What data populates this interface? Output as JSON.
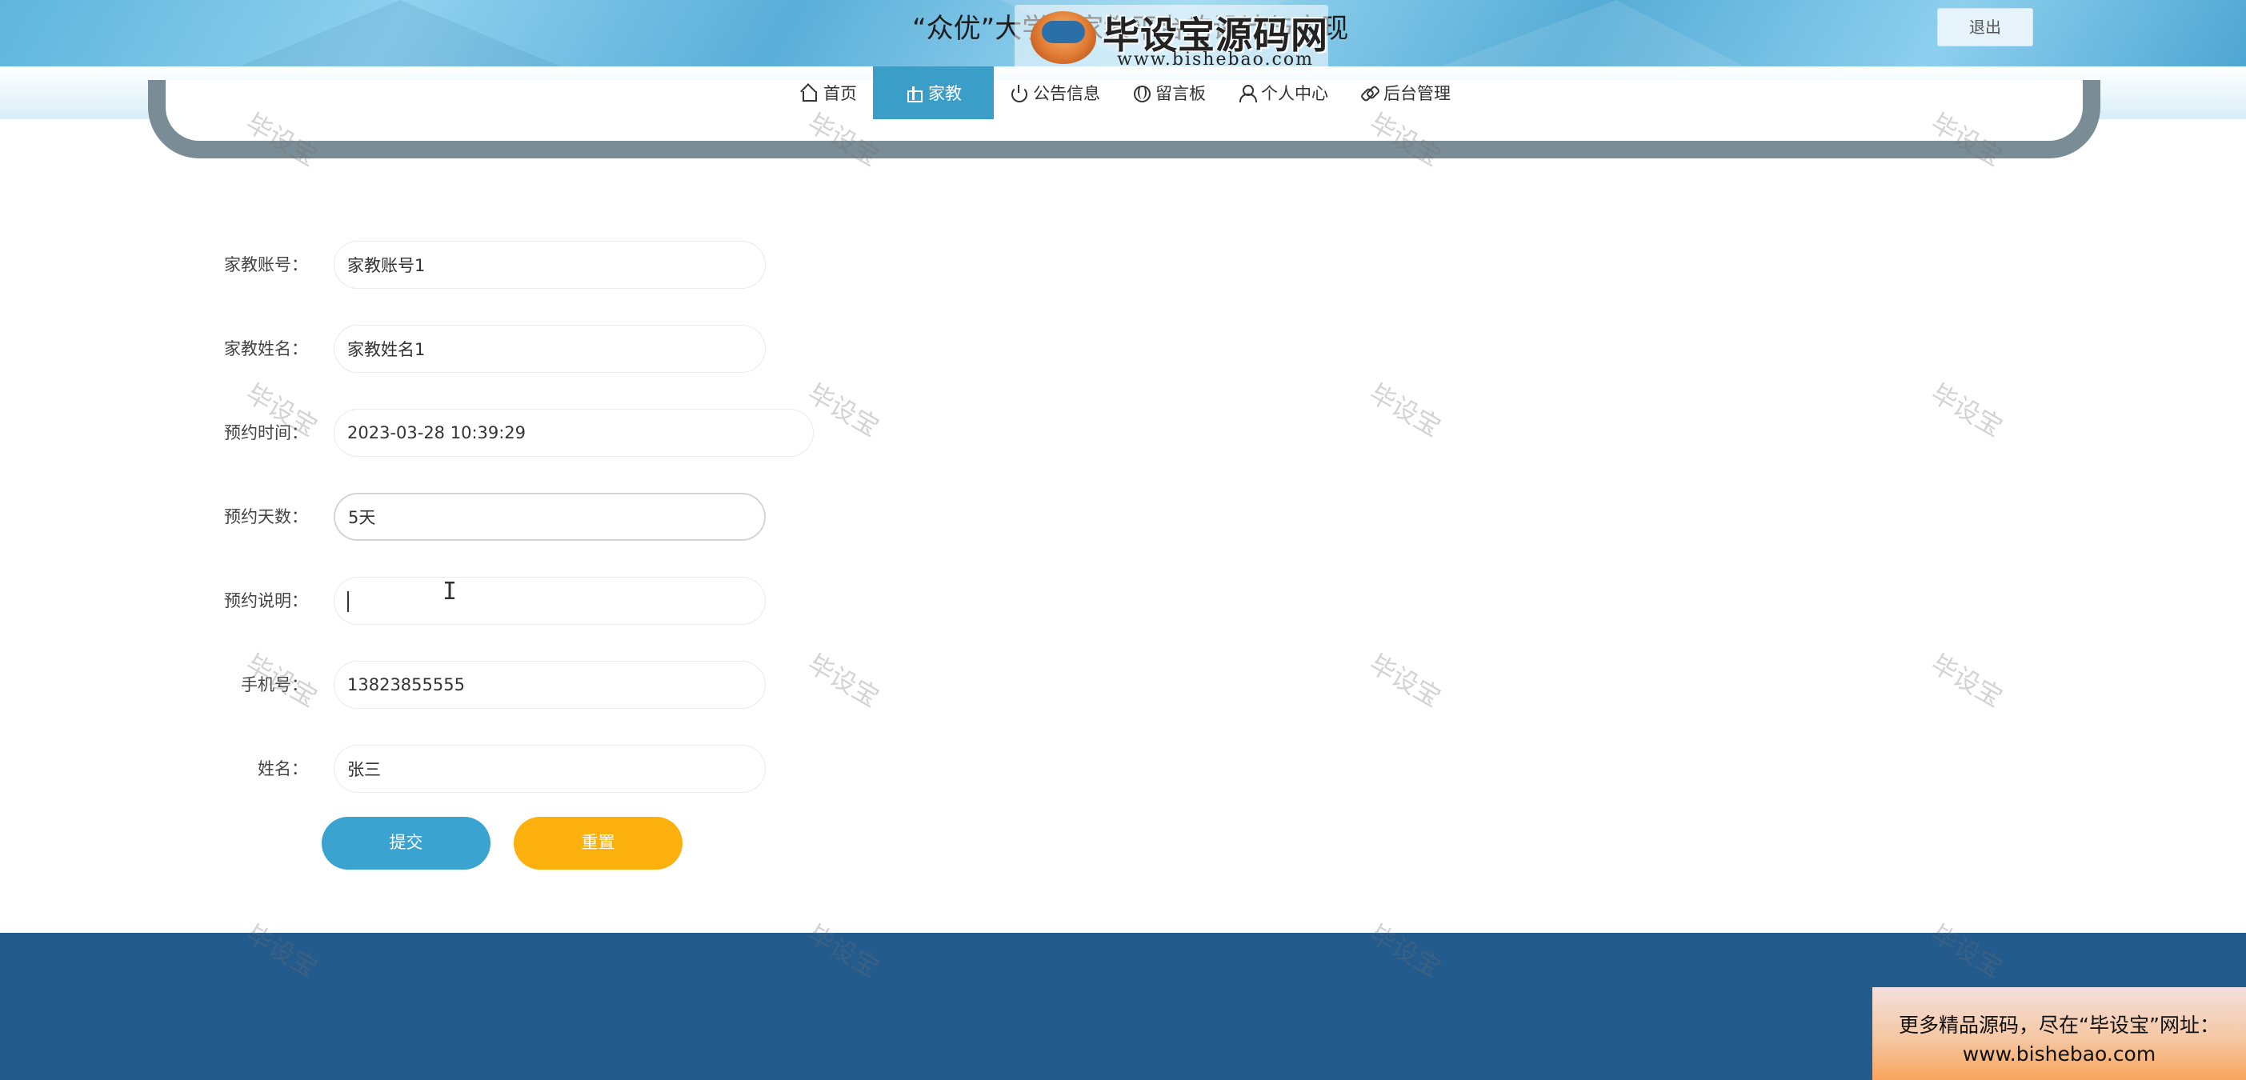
{
  "header": {
    "site_title": "“众优”大学生家教平台的设计与实现",
    "watermark_brand": "毕设宝源码网",
    "watermark_url": "www.bishebao.com",
    "logout_label": "退出"
  },
  "nav": {
    "items": [
      {
        "label": "首页",
        "icon": "home-icon",
        "active": false
      },
      {
        "label": "家教",
        "icon": "gift-icon",
        "active": true
      },
      {
        "label": "公告信息",
        "icon": "power-icon",
        "active": false
      },
      {
        "label": "留言板",
        "icon": "globe-icon",
        "active": false
      },
      {
        "label": "个人中心",
        "icon": "user-icon",
        "active": false
      },
      {
        "label": "后台管理",
        "icon": "link-icon",
        "active": false
      }
    ]
  },
  "form": {
    "tutor_account": {
      "label": "家教账号：",
      "value": "家教账号1"
    },
    "tutor_name": {
      "label": "家教姓名：",
      "value": "家教姓名1"
    },
    "booking_time": {
      "label": "预约时间：",
      "value": "2023-03-28 10:39:29"
    },
    "booking_days": {
      "label": "预约天数：",
      "value": "5天"
    },
    "booking_note": {
      "label": "预约说明：",
      "value": ""
    },
    "phone": {
      "label": "手机号：",
      "value": "13823855555"
    },
    "name": {
      "label": "姓名：",
      "value": "张三"
    },
    "submit_label": "提交",
    "reset_label": "重置"
  },
  "watermark": {
    "text": "毕设宝"
  },
  "promo": {
    "line1": "更多精品源码，尽在“毕设宝”网址：",
    "line2": "www.bishebao.com"
  },
  "colors": {
    "accent": "#3a9ec9",
    "submit": "#3aa3cf",
    "reset": "#fbb00d",
    "footer": "#245b8d"
  }
}
